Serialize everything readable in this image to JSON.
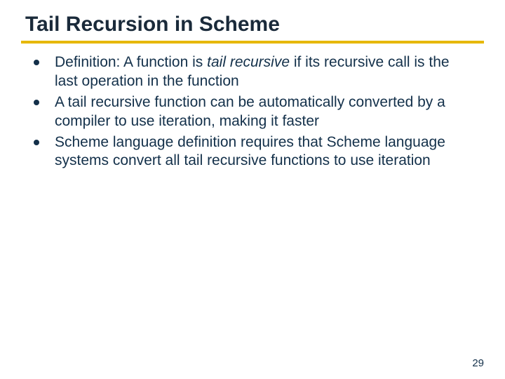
{
  "title": "Tail Recursion in Scheme",
  "bullets": [
    {
      "prefix": "Definition: A function is ",
      "em": "tail recursive",
      "suffix": " if its recursive call is the last operation in the function"
    },
    {
      "prefix": "A tail recursive function can be automatically converted by a compiler to use iteration, making it faster",
      "em": "",
      "suffix": ""
    },
    {
      "prefix": "Scheme language definition requires that Scheme language systems convert all tail recursive functions to use iteration",
      "em": "",
      "suffix": ""
    }
  ],
  "page": "29"
}
